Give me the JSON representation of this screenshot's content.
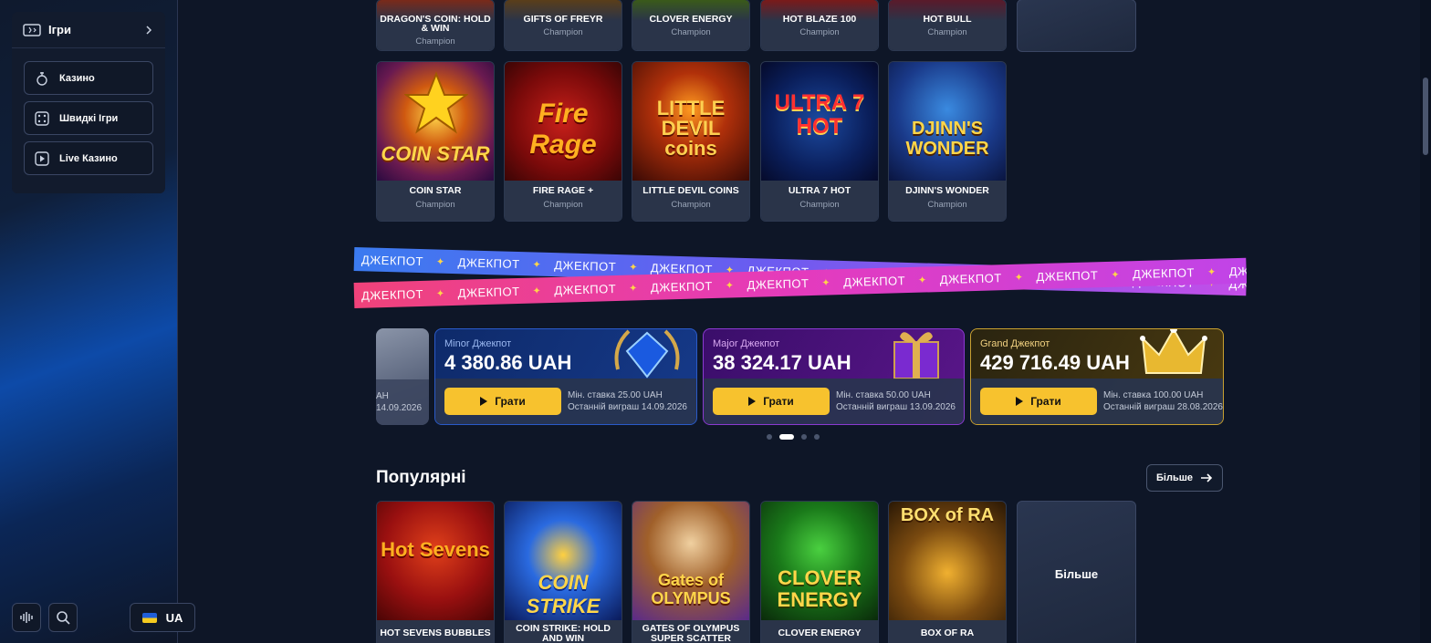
{
  "sidebar": {
    "header": {
      "label": "Ігри"
    },
    "items": [
      {
        "label": "Казино",
        "icon": "casino-icon"
      },
      {
        "label": "Швидкі Ігри",
        "icon": "dice-icon"
      },
      {
        "label": "Live Казино",
        "icon": "play-icon"
      }
    ],
    "bottom": {
      "lang": "UA"
    }
  },
  "top_row": [
    {
      "name": "DRAGON'S COIN: HOLD & WIN",
      "provider": "Champion"
    },
    {
      "name": "GIFTS OF FREYR",
      "provider": "Champion"
    },
    {
      "name": "CLOVER ENERGY",
      "provider": "Champion"
    },
    {
      "name": "HOT BLAZE 100",
      "provider": "Champion"
    },
    {
      "name": "HOT BULL",
      "provider": "Champion"
    }
  ],
  "champion_row": [
    {
      "name": "COIN STAR",
      "provider": "Champion",
      "art": "COIN STAR"
    },
    {
      "name": "FIRE RAGE +",
      "provider": "Champion",
      "art": "Fire Rage"
    },
    {
      "name": "LITTLE DEVIL COINS",
      "provider": "Champion",
      "art": "LITTLE DEVIL coins"
    },
    {
      "name": "ULTRA 7 HOT",
      "provider": "Champion",
      "art": "ULTRA 7 HOT"
    },
    {
      "name": "DJINN'S WONDER",
      "provider": "Champion",
      "art": "DJINN'S WONDER"
    }
  ],
  "jackpot": {
    "ribbon_word": "ДЖЕКПОТ",
    "partial_card": {
      "amount_tail": "AH",
      "date_tail": "14.09.2026"
    },
    "cards": [
      {
        "label": "Minor Джекпот",
        "amount": "4 380.86 UAH",
        "play": "Грати",
        "min_bet": "Мін. ставка 25.00 UAH",
        "last_win": "Останній виграш 14.09.2026"
      },
      {
        "label": "Major Джекпот",
        "amount": "38 324.17 UAH",
        "play": "Грати",
        "min_bet": "Мін. ставка 50.00 UAH",
        "last_win": "Останній виграш 13.09.2026"
      },
      {
        "label": "Grand Джекпот",
        "amount": "429 716.49 UAH",
        "play": "Грати",
        "min_bet": "Мін. ставка 100.00 UAH",
        "last_win": "Останній виграш 28.08.2026"
      }
    ],
    "page_count": 4,
    "active_page": 2
  },
  "popular": {
    "title": "Популярні",
    "more_label": "Більше",
    "games": [
      {
        "name": "HOT SEVENS BUBBLES",
        "art": "Hot Sevens"
      },
      {
        "name": "COIN STRIKE: HOLD AND WIN",
        "art": "COIN STRIKE"
      },
      {
        "name": "GATES OF OLYMPUS SUPER SCATTER",
        "art": "Gates of OLYMPUS"
      },
      {
        "name": "CLOVER ENERGY",
        "art": "CLOVER ENERGY"
      },
      {
        "name": "BOX OF RA",
        "art": "BOX of RA"
      }
    ],
    "more_tile": "Більше"
  },
  "colors": {
    "accent": "#f7c22e",
    "bg": "#0e1627"
  }
}
